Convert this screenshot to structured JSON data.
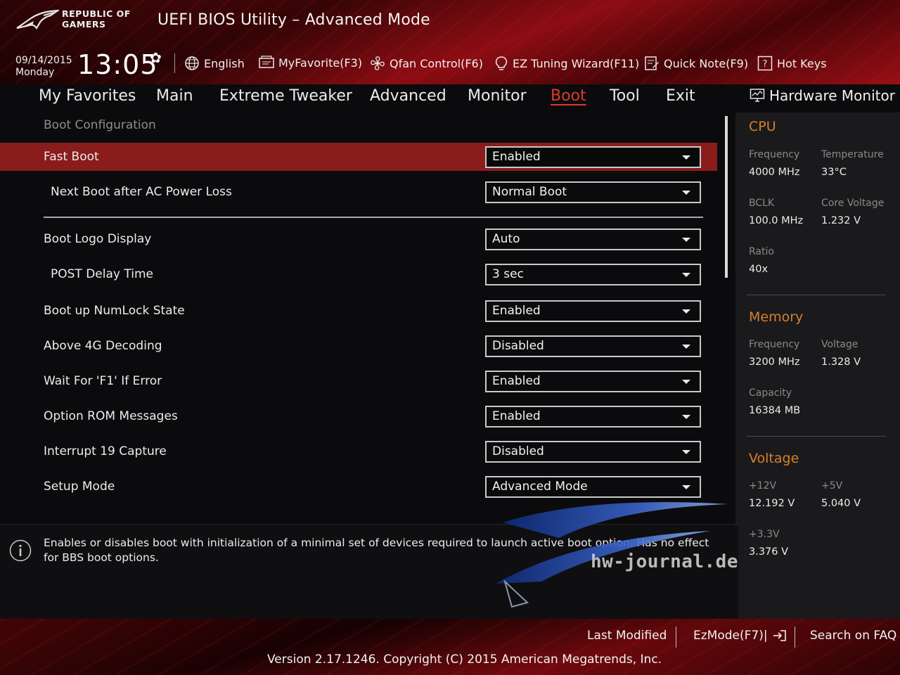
{
  "header": {
    "logo_line1": "REPUBLIC OF",
    "logo_line2": "GAMERS",
    "title": "UEFI BIOS Utility – Advanced Mode",
    "date": "09/14/2015",
    "day": "Monday",
    "time": "13:05"
  },
  "toolbar": [
    {
      "label": "English",
      "icon": "globe-icon"
    },
    {
      "label": "MyFavorite(F3)",
      "icon": "favorites-icon"
    },
    {
      "label": "Qfan Control(F6)",
      "icon": "fan-icon"
    },
    {
      "label": "EZ Tuning Wizard(F11)",
      "icon": "lightbulb-icon"
    },
    {
      "label": "Quick Note(F9)",
      "icon": "note-icon"
    },
    {
      "label": "Hot Keys",
      "icon": "help-icon"
    }
  ],
  "menu": [
    {
      "label": "My Favorites"
    },
    {
      "label": "Main"
    },
    {
      "label": "Extreme Tweaker"
    },
    {
      "label": "Advanced"
    },
    {
      "label": "Monitor"
    },
    {
      "label": "Boot",
      "active": true
    },
    {
      "label": "Tool"
    },
    {
      "label": "Exit"
    }
  ],
  "boot": {
    "section_title": "Boot Configuration",
    "settings": [
      {
        "label": "Fast Boot",
        "value": "Enabled",
        "selected": true
      },
      {
        "label": "Next Boot after AC Power Loss",
        "value": "Normal Boot"
      },
      {
        "label": "Boot Logo Display",
        "value": "Auto"
      },
      {
        "label": "POST Delay Time",
        "value": "3 sec"
      },
      {
        "label": "Boot up NumLock State",
        "value": "Enabled"
      },
      {
        "label": "Above 4G Decoding",
        "value": "Disabled"
      },
      {
        "label": "Wait For 'F1' If Error",
        "value": "Enabled"
      },
      {
        "label": "Option ROM Messages",
        "value": "Enabled"
      },
      {
        "label": "Interrupt 19 Capture",
        "value": "Disabled"
      },
      {
        "label": "Setup Mode",
        "value": "Advanced Mode"
      }
    ]
  },
  "info": {
    "text": "Enables or disables boot with initialization of a minimal set of devices required to launch active boot option. Has no effect for BBS boot options."
  },
  "hardware_monitor": {
    "title": "Hardware Monitor",
    "cpu": {
      "heading": "CPU",
      "frequency_label": "Frequency",
      "frequency": "4000 MHz",
      "temperature_label": "Temperature",
      "temperature": "33°C",
      "bclk_label": "BCLK",
      "bclk": "100.0 MHz",
      "core_voltage_label": "Core Voltage",
      "core_voltage": "1.232 V",
      "ratio_label": "Ratio",
      "ratio": "40x"
    },
    "memory": {
      "heading": "Memory",
      "frequency_label": "Frequency",
      "frequency": "3200 MHz",
      "voltage_label": "Voltage",
      "voltage": "1.328 V",
      "capacity_label": "Capacity",
      "capacity": "16384 MB"
    },
    "voltage": {
      "heading": "Voltage",
      "v12_label": "+12V",
      "v12": "12.192 V",
      "v5_label": "+5V",
      "v5": "5.040 V",
      "v33_label": "+3.3V",
      "v33": "3.376 V"
    }
  },
  "footer": {
    "last_modified": "Last Modified",
    "ezmode": "EzMode(F7)|",
    "search_faq": "Search on FAQ",
    "version": "Version 2.17.1246. Copyright (C) 2015 American Megatrends, Inc."
  },
  "watermark": {
    "text": "hw-journal.de"
  },
  "colors": {
    "accent_red": "#e0382b",
    "selected_row": "#8a1c1c",
    "section_heading": "#d6802a"
  }
}
